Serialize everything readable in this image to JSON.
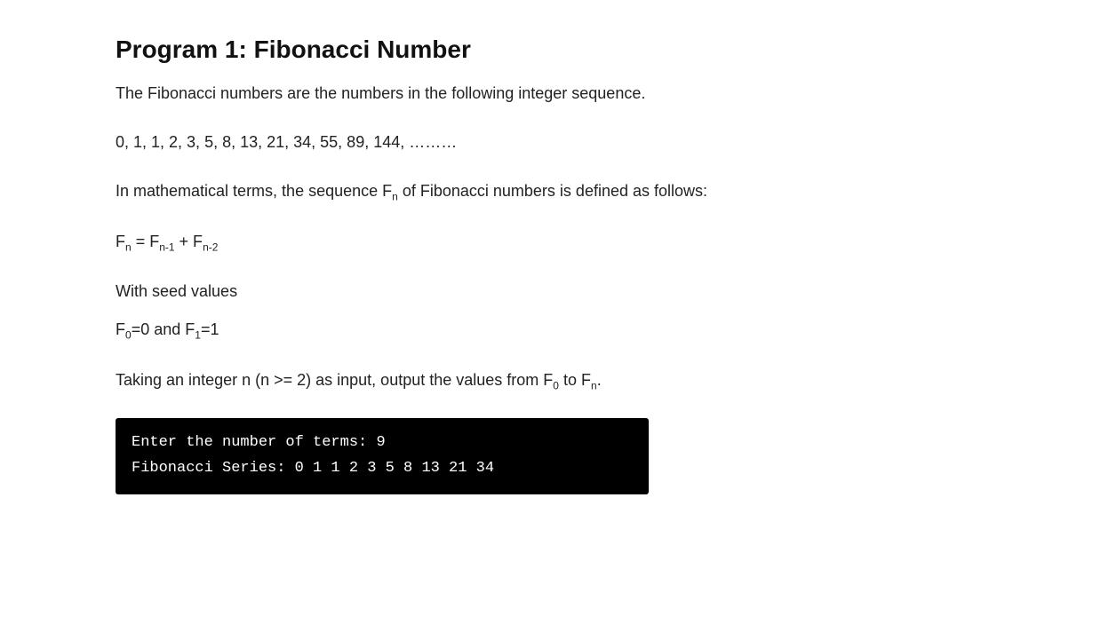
{
  "page": {
    "title": "Program 1: Fibonacci Number",
    "intro": "The Fibonacci numbers are the numbers in the following integer sequence.",
    "sequence": "0, 1, 1, 2, 3, 5, 8, 13, 21, 34, 55, 89, 144, ………",
    "math_intro": "In mathematical terms, the sequence F",
    "math_sub_n": "n",
    "math_rest": " of Fibonacci numbers is defined as follows:",
    "formula_lhs": "F",
    "formula_lhs_sub": "n",
    "formula_rhs1": "F",
    "formula_rhs1_sub": "n-1",
    "formula_plus": " + ",
    "formula_rhs2": "F",
    "formula_rhs2_sub": "n-2",
    "seed_label": "With seed values",
    "seed_values": "F₀=0 and F₁=1",
    "input_desc_pre": "Taking an integer n (n >= 2) as input, output the values from F",
    "input_sub_0": "0",
    "input_middle": " to F",
    "input_sub_n": "n",
    "input_end": ".",
    "terminal": {
      "line1": "Enter the number of terms: 9",
      "line2": "Fibonacci Series: 0 1 1 2 3 5 8 13 21 34"
    }
  }
}
